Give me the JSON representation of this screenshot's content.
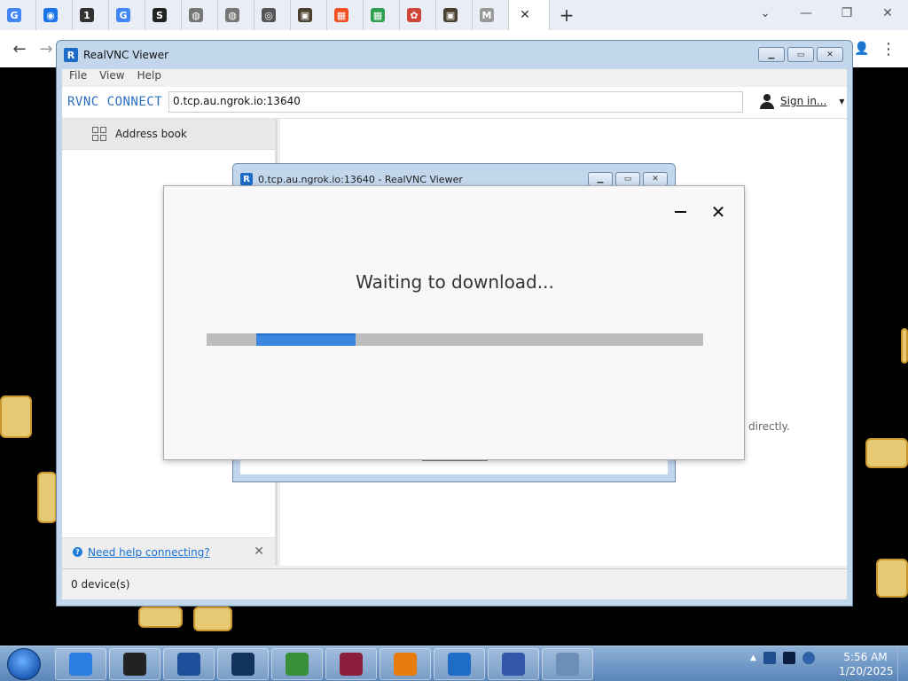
{
  "browser": {
    "tabs": [
      {
        "icon": "google-icon",
        "glyph": "G",
        "color": "#4285f4",
        "title": "G"
      },
      {
        "icon": "globe-blue-icon",
        "glyph": "◉",
        "color": "#1a73e8",
        "title": ""
      },
      {
        "icon": "one-password-icon",
        "glyph": "1",
        "color": "#333333",
        "title": "1"
      },
      {
        "icon": "google-icon",
        "glyph": "G",
        "color": "#4285f4",
        "title": "G"
      },
      {
        "icon": "s-icon",
        "glyph": "S",
        "color": "#222222",
        "title": "S"
      },
      {
        "icon": "globe-icon",
        "glyph": "◍",
        "color": "#777777",
        "title": ""
      },
      {
        "icon": "globe-icon",
        "glyph": "◍",
        "color": "#777777",
        "title": ""
      },
      {
        "icon": "chrome-icon",
        "glyph": "◎",
        "color": "#555555",
        "title": ""
      },
      {
        "icon": "image-icon",
        "glyph": "▣",
        "color": "#4a4030",
        "title": ""
      },
      {
        "icon": "microsoft-icon",
        "glyph": "▦",
        "color": "#f25022",
        "title": ""
      },
      {
        "icon": "green-icon",
        "glyph": "▦",
        "color": "#2e9e4f",
        "title": ""
      },
      {
        "icon": "red-flower-icon",
        "glyph": "✿",
        "color": "#d0453a",
        "title": ""
      },
      {
        "icon": "image-icon",
        "glyph": "▣",
        "color": "#4a4030",
        "title": ""
      },
      {
        "icon": "audio-tab-icon",
        "glyph": "M",
        "color": "#999999",
        "title": "M"
      }
    ],
    "close_glyph": "✕",
    "newtab_glyph": "+",
    "window_controls": {
      "dropdown": "⌄",
      "minimize": "—",
      "restore": "❐",
      "close": "✕"
    },
    "nav": {
      "back": "←",
      "forward": "→",
      "profile": "👤",
      "menu": "⋮"
    }
  },
  "vnc": {
    "title": "RealVNC Viewer",
    "logo": "R",
    "menu": [
      "File",
      "View",
      "Help"
    ],
    "brand": "RVNC CONNECT",
    "address": "0.tcp.au.ngrok.io:13640",
    "sign_in": "Sign in...",
    "sign_in_caret": "▾",
    "address_book": "Address book",
    "help_link": "Need help connecting?",
    "help_close": "✕",
    "directly_text": "directly.",
    "device_count": "0 device(s)"
  },
  "child_window": {
    "title": "0.tcp.au.ngrok.io:13640 - RealVNC Viewer"
  },
  "dialog": {
    "message": "Waiting to download...",
    "close_glyph": "✕",
    "progress": {
      "start_fraction": 0.1,
      "fill_fraction": 0.2
    }
  },
  "taskbar": {
    "time": "5:56 AM",
    "date": "1/20/2025",
    "apps": [
      {
        "name": "internet-explorer-icon",
        "color": "#2a7de1"
      },
      {
        "name": "dark-box-icon",
        "color": "#222222"
      },
      {
        "name": "media-player-icon",
        "color": "#1d4f9a"
      },
      {
        "name": "globe-network-icon",
        "color": "#12325e"
      },
      {
        "name": "browser-app-icon",
        "color": "#3a8f3a"
      },
      {
        "name": "winrar-icon",
        "color": "#8b1e3f"
      },
      {
        "name": "blender-icon",
        "color": "#e87d0d"
      },
      {
        "name": "realvnc-icon",
        "color": "#1e6cc5"
      },
      {
        "name": "plane-app-icon",
        "color": "#3355aa"
      },
      {
        "name": "notepad-clock-icon",
        "color": "#6c8fb8"
      }
    ]
  }
}
